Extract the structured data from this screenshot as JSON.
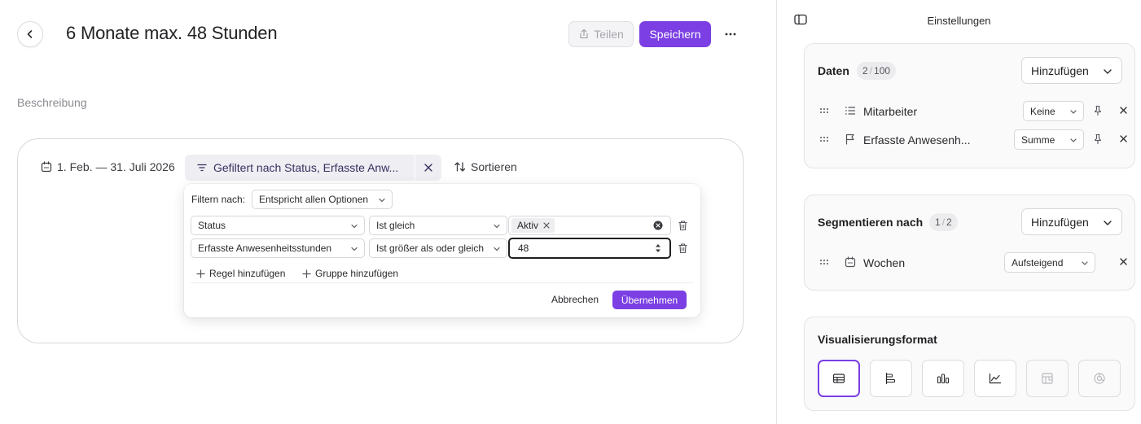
{
  "header": {
    "title": "6 Monate max. 48 Stunden",
    "share_label": "Teilen",
    "save_label": "Speichern"
  },
  "description_label": "Beschreibung",
  "toolbar": {
    "date_range": "1. Feb. — 31. Juli 2026",
    "filter_summary": "Gefiltert nach Status, Erfasste Anw...",
    "sort_label": "Sortieren"
  },
  "filter_popover": {
    "filter_by_label": "Filtern nach:",
    "match_mode": "Entspricht allen Optionen",
    "rules": [
      {
        "field": "Status",
        "operator": "Ist gleich",
        "value_tag": "Aktiv"
      },
      {
        "field": "Erfasste Anwesenheitsstunden",
        "operator": "Ist größer als oder gleich",
        "value": "48"
      }
    ],
    "add_rule_label": "Regel hinzufügen",
    "add_group_label": "Gruppe hinzufügen",
    "cancel_label": "Abbrechen",
    "apply_label": "Übernehmen"
  },
  "settings_panel": {
    "title": "Einstellungen",
    "data_section": {
      "title": "Daten",
      "count_used": "2",
      "count_max": "100",
      "add_label": "Hinzufügen",
      "items": [
        {
          "label": "Mitarbeiter",
          "aggregation": "Keine",
          "icon": "list-icon"
        },
        {
          "label": "Erfasste Anwesenh...",
          "aggregation": "Summe",
          "icon": "flag-icon"
        }
      ]
    },
    "segment_section": {
      "title": "Segmentieren nach",
      "count_used": "1",
      "count_max": "2",
      "add_label": "Hinzufügen",
      "items": [
        {
          "label": "Wochen",
          "order": "Aufsteigend",
          "icon": "calendar-icon"
        }
      ]
    },
    "viz_section": {
      "title": "Visualisierungsformat",
      "formats": [
        "table-icon",
        "horizontal-bar-icon",
        "bar-chart-icon",
        "line-chart-icon",
        "pivot-icon",
        "donut-icon"
      ],
      "selected": "table-icon"
    }
  },
  "colors": {
    "accent": "#7b3fe4",
    "chip_background": "#efeef3",
    "panel_section_background": "#fafafa"
  }
}
